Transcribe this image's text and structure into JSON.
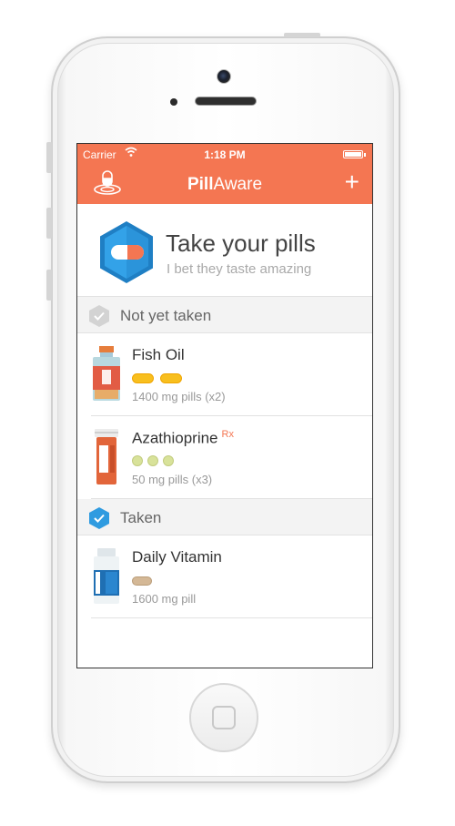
{
  "status_bar": {
    "carrier": "Carrier",
    "time": "1:18 PM"
  },
  "navbar": {
    "title_bold": "Pill",
    "title_light": "Aware",
    "add_label": "+"
  },
  "header": {
    "title": "Take your pills",
    "subtitle": "I bet they taste amazing"
  },
  "sections": {
    "not_taken": {
      "label": "Not yet taken"
    },
    "taken": {
      "label": "Taken"
    }
  },
  "medications_not_taken": [
    {
      "name": "Fish Oil",
      "rx": "",
      "dose": "1400 mg pills (x2)",
      "pill_type": "capsule",
      "pill_count": 2
    },
    {
      "name": "Azathioprine",
      "rx": "Rx",
      "dose": "50 mg pills (x3)",
      "pill_type": "tablet",
      "pill_count": 3
    }
  ],
  "medications_taken": [
    {
      "name": "Daily Vitamin",
      "rx": "",
      "dose": "1600 mg pill",
      "pill_type": "oval",
      "pill_count": 1
    }
  ],
  "colors": {
    "accent": "#f47652",
    "hex_blue": "#2f9be0",
    "capsule": "#f8bf1e"
  },
  "icons": {
    "nav_left": "pill-drop-icon",
    "add": "plus-icon",
    "header": "pill-capsule-hex-icon",
    "not_taken_section": "check-hex-gray-icon",
    "taken_section": "check-hex-blue-icon"
  }
}
